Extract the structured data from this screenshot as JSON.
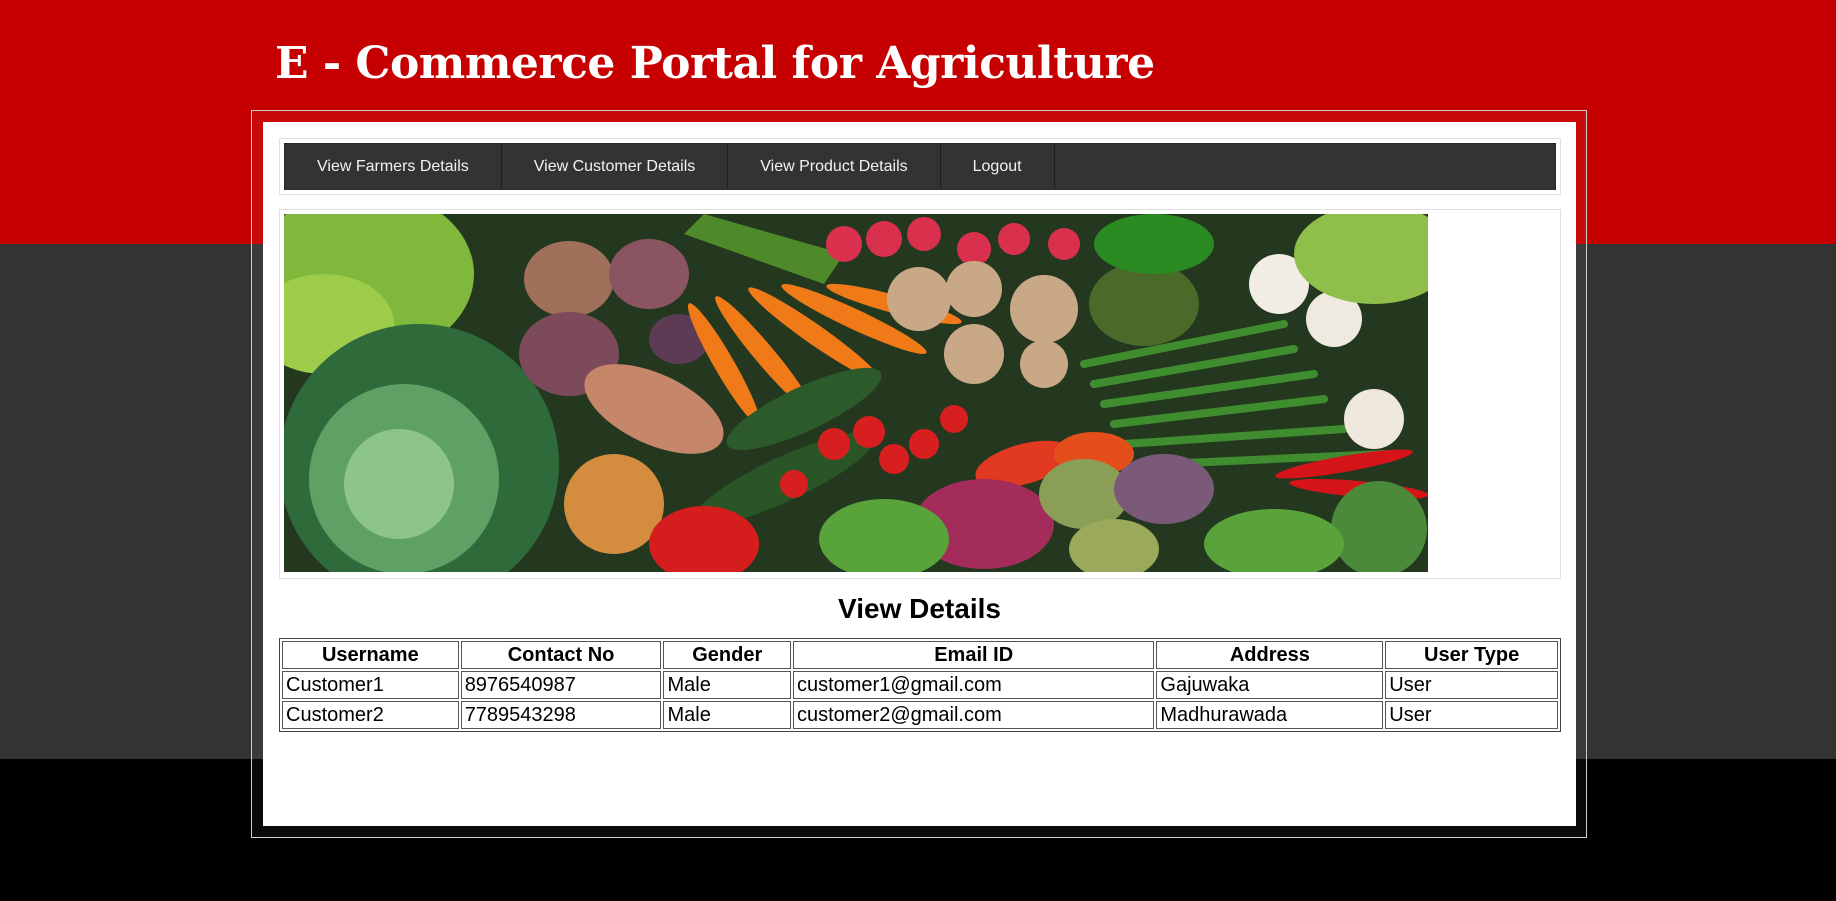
{
  "header": {
    "title": "E - Commerce Portal for Agriculture"
  },
  "nav": {
    "items": [
      {
        "label": "View Farmers Details"
      },
      {
        "label": "View Customer Details"
      },
      {
        "label": "View Product Details"
      },
      {
        "label": "Logout"
      }
    ]
  },
  "main": {
    "heading": "View Details",
    "table": {
      "headers": [
        "Username",
        "Contact No",
        "Gender",
        "Email ID",
        "Address",
        "User Type"
      ],
      "rows": [
        [
          "Customer1",
          "8976540987",
          "Male",
          "customer1@gmail.com",
          "Gajuwaka",
          "User"
        ],
        [
          "Customer2",
          "7789543298",
          "Male",
          "customer2@gmail.com",
          "Madhurawada",
          "User"
        ]
      ]
    }
  },
  "colors": {
    "header_red": "#c60000",
    "nav_bg": "#333333",
    "page_gray": "#333333",
    "page_black": "#000000"
  }
}
